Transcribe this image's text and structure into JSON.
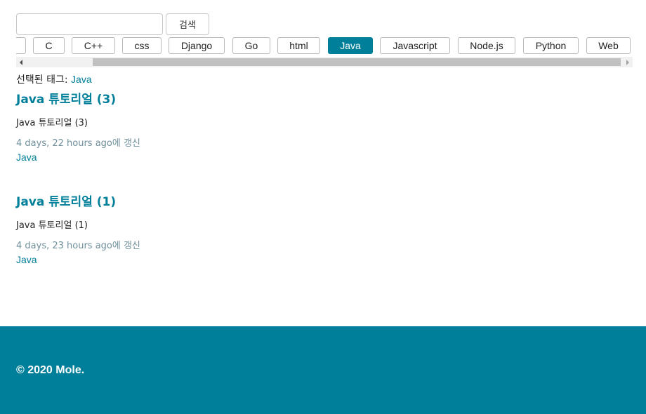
{
  "search": {
    "value": "",
    "placeholder": "",
    "button_label": "검색"
  },
  "tags": [
    {
      "label": "",
      "active": false
    },
    {
      "label": "C",
      "active": false
    },
    {
      "label": "C++",
      "active": false
    },
    {
      "label": "css",
      "active": false
    },
    {
      "label": "Django",
      "active": false
    },
    {
      "label": "Go",
      "active": false
    },
    {
      "label": "html",
      "active": false
    },
    {
      "label": "Java",
      "active": true
    },
    {
      "label": "Javascript",
      "active": false
    },
    {
      "label": "Node.js",
      "active": false
    },
    {
      "label": "Python",
      "active": false
    },
    {
      "label": "Web",
      "active": false
    }
  ],
  "selected": {
    "prefix": "선택된 태그: ",
    "tag": "Java"
  },
  "posts": [
    {
      "title": "Java 튜토리얼 (3)",
      "excerpt": "Java 튜토리얼 (3)",
      "updated": "4 days, 22 hours ago에 갱신",
      "tag": "Java"
    },
    {
      "title": "Java 튜토리얼 (1)",
      "excerpt": "Java 튜토리얼 (1)",
      "updated": "4 days, 23 hours ago에 갱신",
      "tag": "Java"
    }
  ],
  "footer": {
    "text": "© 2020 Mole."
  },
  "colors": {
    "accent": "#007f9a",
    "meta_text": "#6f8f9a"
  },
  "icons": {
    "scroll_left": "arrow-left-icon",
    "scroll_right": "arrow-right-icon"
  }
}
